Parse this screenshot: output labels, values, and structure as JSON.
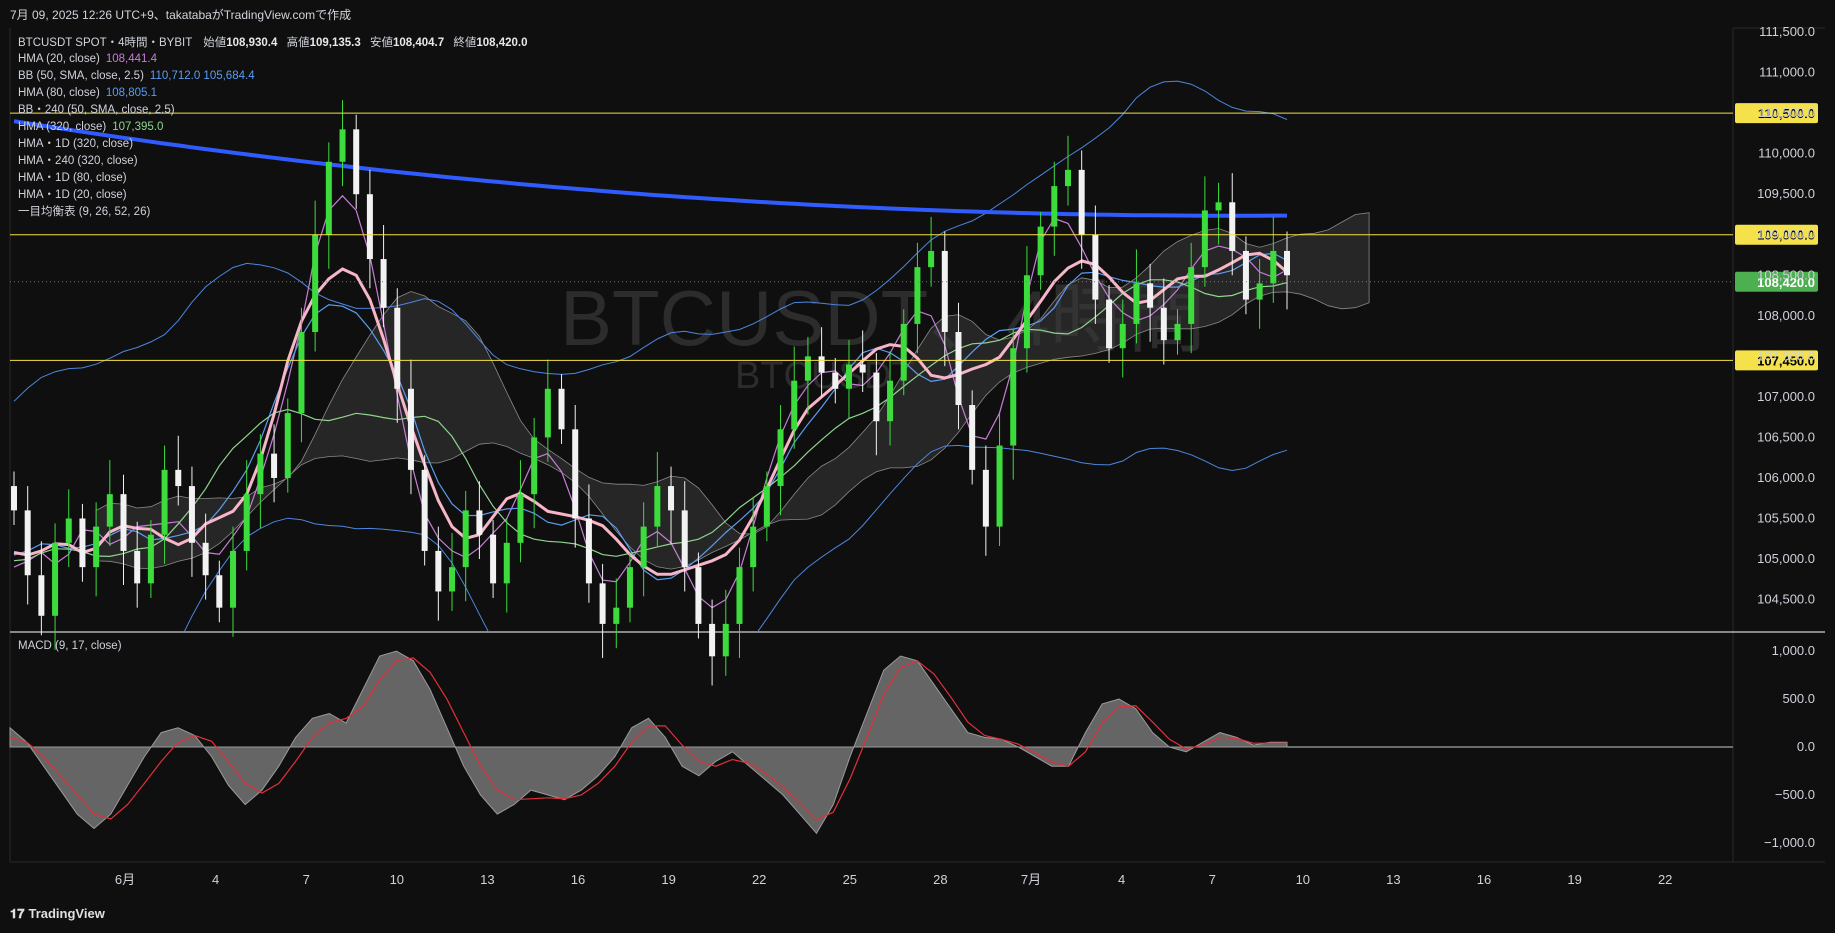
{
  "header": {
    "created": "7月 09, 2025 12:26 UTC+9、takatabaがTradingView.comで作成"
  },
  "ohlc": {
    "symbol": "BTCUSDT SPOT・4時間・BYBIT",
    "o_label": "始値",
    "o": "108,930.4",
    "h_label": "高値",
    "h": "109,135.3",
    "l_label": "安値",
    "l": "108,404.7",
    "c_label": "終値",
    "c": "108,420.0"
  },
  "indicators": [
    {
      "label": "HMA (20, close)",
      "value": "108,441.4",
      "color": "#c77dd6"
    },
    {
      "label": "BB (50, SMA, close, 2.5)",
      "value": "110,712.0  105,684.4",
      "color": "#5b9cf2"
    },
    {
      "label": "HMA (80, close)",
      "value": "108,805.1",
      "color": "#5b9cf2"
    },
    {
      "label": "BB・240 (50, SMA, close, 2.5)",
      "value": "",
      "color": "#d1d4dc"
    },
    {
      "label": "HMA (320, close)",
      "value": "107,395.0",
      "color": "#8fd48f"
    },
    {
      "label": "HMA・1D (320, close)",
      "value": "",
      "color": "#d1d4dc"
    },
    {
      "label": "HMA・240 (320, close)",
      "value": "",
      "color": "#d1d4dc"
    },
    {
      "label": "HMA・1D (80, close)",
      "value": "",
      "color": "#d1d4dc"
    },
    {
      "label": "HMA・1D (20, close)",
      "value": "",
      "color": "#d1d4dc"
    },
    {
      "label": "一目均衡表 (9, 26, 52, 26)",
      "value": "",
      "color": "#d1d4dc"
    }
  ],
  "macd_label": "MACD (9, 17, close)",
  "watermark": {
    "main": "BTCUSDT、4時間",
    "sub": "BTCUSDT"
  },
  "logo": "TradingView",
  "colors": {
    "background": "#0f0f0f",
    "up": "#3ddc3d",
    "down": "#f2f2f2",
    "hma20": "#c77dd6",
    "hma80": "#5b9cf2",
    "hma320": "#8fd48f",
    "hma1d": "#2f5bff",
    "hma240": "#f7b6c8",
    "level": "#f5e14a",
    "price_badge": "#4caf50",
    "macd_signal": "#e0303a"
  },
  "chart_data": [
    {
      "type": "line",
      "title": "BTCUSDT 4時間",
      "y_axis_ticks": [
        "111,500.0",
        "111,000.0",
        "110,500.0",
        "110,000.0",
        "109,500.0",
        "109,000.0",
        "108,500.0",
        "108,000.0",
        "107,500.0",
        "107,000.0",
        "106,500.0",
        "106,000.0",
        "105,500.0",
        "105,000.0",
        "104,500.0"
      ],
      "ylim": [
        104100,
        111550
      ],
      "x_axis_ticks": [
        "6月",
        "4",
        "7",
        "10",
        "13",
        "16",
        "19",
        "22",
        "25",
        "28",
        "7月",
        "4",
        "7",
        "10",
        "13",
        "16",
        "19",
        "22"
      ],
      "horizontal_levels": [
        {
          "price": 110500,
          "label": "110,500.0"
        },
        {
          "price": 109000,
          "label": "109,000.0"
        },
        {
          "price": 107450,
          "label": "107,450.0"
        }
      ],
      "current_price": {
        "price": 108420,
        "label": "108,420.0"
      },
      "close_series": [
        105600,
        104800,
        104300,
        105200,
        105500,
        104900,
        105400,
        105800,
        105100,
        104700,
        105300,
        106100,
        105900,
        105200,
        104800,
        104400,
        105100,
        105800,
        106300,
        106000,
        106800,
        107800,
        109000,
        109900,
        110300,
        109500,
        108700,
        108100,
        107100,
        106100,
        105100,
        104600,
        104900,
        105600,
        105300,
        104700,
        105200,
        105800,
        106500,
        107100,
        106600,
        105500,
        104700,
        104200,
        104400,
        104900,
        105400,
        105900,
        105600,
        104900,
        104200,
        103800,
        104200,
        104900,
        105400,
        105900,
        106600,
        107200,
        107500,
        107300,
        107100,
        107400,
        107300,
        106700,
        107200,
        107900,
        108600,
        108800,
        107800,
        106900,
        106100,
        105400,
        106400,
        107600,
        108500,
        109100,
        109600,
        109800,
        109000,
        108200,
        107600,
        107900,
        108400,
        108100,
        107700,
        107900,
        108600,
        109300,
        109400,
        108800,
        108200,
        108400,
        108800,
        108500
      ]
    },
    {
      "type": "area",
      "title": "MACD (9, 17, close)",
      "y_axis_ticks": [
        "1,000.0",
        "500.0",
        "0.0",
        "−500.0",
        "−1,000.0"
      ],
      "ylim": [
        -1200,
        1200
      ],
      "macd": [
        200,
        50,
        -200,
        -450,
        -700,
        -850,
        -700,
        -400,
        -100,
        150,
        200,
        120,
        -100,
        -400,
        -600,
        -450,
        -200,
        100,
        300,
        350,
        250,
        600,
        950,
        1000,
        900,
        600,
        200,
        -200,
        -500,
        -700,
        -600,
        -450,
        -500,
        -550,
        -450,
        -300,
        -100,
        200,
        300,
        100,
        -200,
        -300,
        -150,
        -50,
        -200,
        -350,
        -500,
        -700,
        -900,
        -600,
        -100,
        350,
        800,
        950,
        900,
        650,
        400,
        150,
        100,
        80,
        0,
        -100,
        -200,
        -200,
        150,
        450,
        500,
        400,
        150,
        0,
        -50,
        50,
        150,
        100,
        20,
        50,
        50
      ],
      "signal": [
        100,
        50,
        -100,
        -300,
        -500,
        -700,
        -750,
        -600,
        -380,
        -150,
        50,
        120,
        60,
        -150,
        -380,
        -480,
        -380,
        -150,
        100,
        250,
        300,
        420,
        700,
        900,
        930,
        780,
        500,
        150,
        -200,
        -450,
        -550,
        -540,
        -530,
        -540,
        -500,
        -380,
        -200,
        50,
        220,
        220,
        20,
        -150,
        -200,
        -130,
        -170,
        -280,
        -420,
        -580,
        -760,
        -680,
        -330,
        100,
        550,
        830,
        900,
        760,
        520,
        260,
        120,
        80,
        30,
        -60,
        -160,
        -200,
        -50,
        250,
        420,
        430,
        260,
        80,
        -20,
        20,
        100,
        90,
        40,
        40,
        40
      ]
    }
  ]
}
